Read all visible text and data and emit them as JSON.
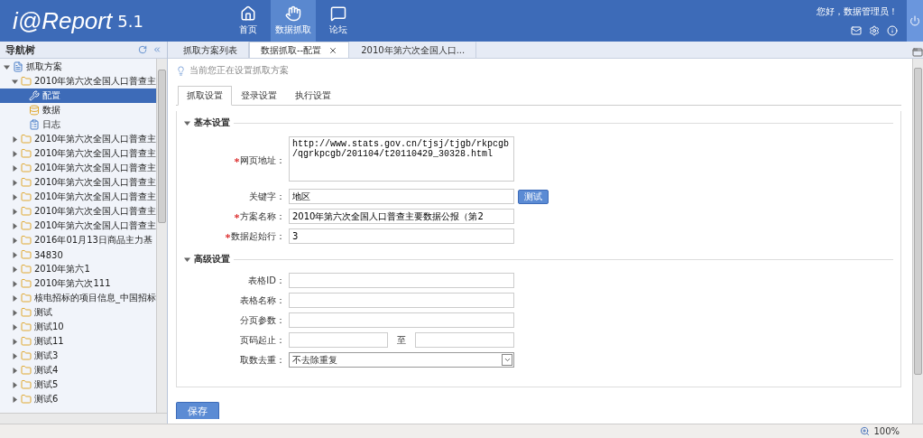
{
  "header": {
    "logo": "i@Report",
    "version": "5.1",
    "nav": [
      {
        "label": "首页",
        "selected": false
      },
      {
        "label": "数据抓取",
        "selected": true
      },
      {
        "label": "论坛",
        "selected": false
      }
    ],
    "greeting": "您好，数据管理员！"
  },
  "sidebar": {
    "title": "导航树",
    "tree": [
      {
        "label": "抓取方案",
        "expanded": true,
        "selected": false,
        "children": [
          {
            "label": "2010年第六次全国人口普查主",
            "expanded": true,
            "selected": false,
            "children": [
              {
                "label": "配置",
                "selected": true
              },
              {
                "label": "数据",
                "selected": false
              },
              {
                "label": "日志",
                "selected": false
              }
            ]
          },
          {
            "label": "2010年第六次全国人口普查主",
            "expanded": false,
            "selected": false
          },
          {
            "label": "2010年第六次全国人口普查主",
            "expanded": false,
            "selected": false
          },
          {
            "label": "2010年第六次全国人口普查主",
            "expanded": false,
            "selected": false
          },
          {
            "label": "2010年第六次全国人口普查主",
            "expanded": false,
            "selected": false
          },
          {
            "label": "2010年第六次全国人口普查主",
            "expanded": false,
            "selected": false
          },
          {
            "label": "2010年第六次全国人口普查主",
            "expanded": false,
            "selected": false
          },
          {
            "label": "2010年第六次全国人口普查主",
            "expanded": false,
            "selected": false
          },
          {
            "label": "2016年01月13日商品主力基",
            "expanded": false,
            "selected": false
          },
          {
            "label": "34830",
            "expanded": false,
            "selected": false
          },
          {
            "label": "2010年第六1",
            "expanded": false,
            "selected": false
          },
          {
            "label": "2010年第六次111",
            "expanded": false,
            "selected": false
          },
          {
            "label": "核电招标的项目信息_中国招标",
            "expanded": false,
            "selected": false
          },
          {
            "label": "测试",
            "expanded": false,
            "selected": false
          },
          {
            "label": "测试10",
            "expanded": false,
            "selected": false
          },
          {
            "label": "测试11",
            "expanded": false,
            "selected": false
          },
          {
            "label": "测试3",
            "expanded": false,
            "selected": false
          },
          {
            "label": "测试4",
            "expanded": false,
            "selected": false
          },
          {
            "label": "测试5",
            "expanded": false,
            "selected": false
          },
          {
            "label": "测试6",
            "expanded": false,
            "selected": false
          }
        ]
      }
    ]
  },
  "tabs": [
    {
      "label": "抓取方案列表",
      "selected": false
    },
    {
      "label": "数据抓取--配置",
      "selected": true,
      "closable": true
    },
    {
      "label": "2010年第六次全国人口...",
      "selected": false
    }
  ],
  "hint": "当前您正在设置抓取方案",
  "sub_tabs": [
    {
      "label": "抓取设置",
      "selected": true
    },
    {
      "label": "登录设置",
      "selected": false
    },
    {
      "label": "执行设置",
      "selected": false
    }
  ],
  "sections": [
    {
      "title": "基本设置",
      "expanded": true,
      "fields": [
        {
          "kind": "textarea",
          "label": "网页地址：",
          "required": true,
          "value": "http://www.stats.gov.cn/tjsj/tjgb/rkpcgb/qgrkpcgb/201104/t20110429_30328.html"
        },
        {
          "kind": "text_button",
          "label": "关键字：",
          "value": "地区",
          "button": "测试"
        },
        {
          "kind": "text",
          "label": "方案名称：",
          "required": true,
          "value": "2010年第六次全国人口普查主要数据公报（第2"
        },
        {
          "kind": "text",
          "label": "数据起始行：",
          "required": true,
          "value": "3"
        }
      ]
    },
    {
      "title": "高级设置",
      "expanded": true,
      "fields": [
        {
          "kind": "text",
          "label": "表格ID："
        },
        {
          "kind": "text",
          "label": "表格名称："
        },
        {
          "kind": "text",
          "label": "分页参数："
        },
        {
          "kind": "range",
          "label": "页码起止：",
          "separator": "至"
        },
        {
          "kind": "select",
          "label": "取数去重：",
          "value": "不去除重复"
        }
      ]
    }
  ],
  "save_button": "保存",
  "status_bar": {
    "zoom": "100%"
  }
}
